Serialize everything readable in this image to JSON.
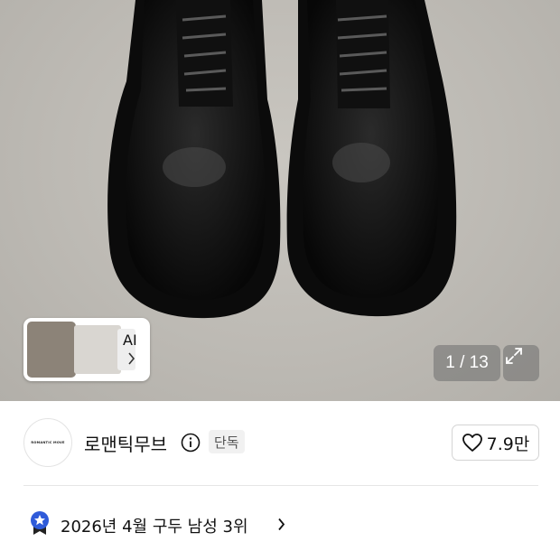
{
  "gallery": {
    "ai_label": "AI",
    "counter": "1 / 13",
    "icons": {
      "expand": "expand-arrows-icon",
      "chevron": "chevron-right-icon"
    }
  },
  "brand": {
    "logo_text": "ROMANTIC MOVE",
    "name": "로맨틱무브",
    "exclusive_badge": "단독",
    "like_count": "7.9만",
    "icons": {
      "info": "info-circle-icon",
      "heart": "heart-outline-icon"
    }
  },
  "ranking": {
    "text": "2026년 4월 구두 남성 3위",
    "icons": {
      "badge": "star-ribbon-icon",
      "chevron": "chevron-right-icon"
    },
    "badge_color": "#2f5bd9"
  }
}
